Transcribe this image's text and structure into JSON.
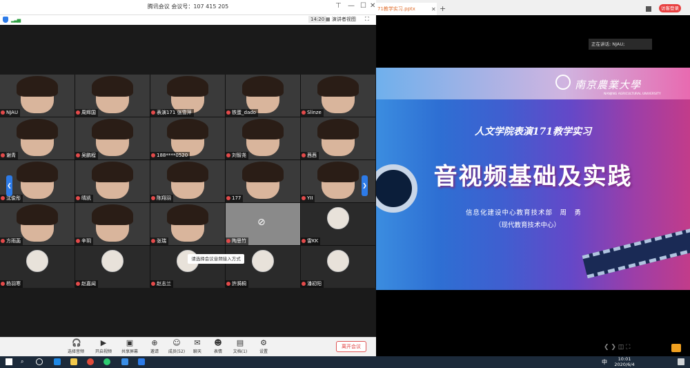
{
  "meeting": {
    "title": "腾讯会议 会议号：107 415 205",
    "clock": "14:20",
    "view_label": "演讲者视图",
    "tooltip": "请选择会议音频接入方式",
    "leave_label": "离开会议",
    "participants": [
      "NJAU",
      "周辉国",
      "表演171 张雪萍",
      "铁蛋_dado",
      "Slinze",
      "谢青",
      "吴鹏程",
      "188****0520",
      "刘智尧",
      "茜茜",
      "沈俊彤",
      "晴凯",
      "陈翔羽",
      "177",
      "YII",
      "方雨菡",
      "辛玥",
      "张瑞",
      "陶思竹",
      "雷KK",
      "杨羽寒",
      "赵嘉闻",
      "赵志兰",
      "許漪桐",
      "潘初阳"
    ],
    "toolbar": [
      {
        "label": "选择音频",
        "icon": "headset-icon"
      },
      {
        "label": "开启视频",
        "icon": "camera-off-icon"
      },
      {
        "label": "共享屏幕",
        "icon": "share-screen-icon"
      },
      {
        "label": "邀请",
        "icon": "invite-icon"
      },
      {
        "label": "成员(52)",
        "icon": "members-icon"
      },
      {
        "label": "聊天",
        "icon": "chat-icon"
      },
      {
        "label": "表情",
        "icon": "emoji-icon"
      },
      {
        "label": "文档(1)",
        "icon": "document-icon"
      },
      {
        "label": "设置",
        "icon": "settings-icon"
      }
    ]
  },
  "ppt": {
    "tab_title": "71教学实习.pptx",
    "login_button": "访客登录",
    "speaking": "正在讲话: NJAU;",
    "slide": {
      "school": "南京農業大學",
      "school_en": "NANJING AGRICULTURAL UNIVERSITY",
      "subtitle": "人文学院表演171教学实习",
      "main_title": "音视频基础及实践",
      "dept": "信息化建设中心教育技术部　周　勇",
      "dept2": "（现代教育技术中心）"
    }
  },
  "taskbar": {
    "time": "10:01",
    "date": "2020/6/4",
    "ime": "中"
  },
  "colors": {
    "accent_blue": "#2d7be8",
    "leave_red": "#e04040",
    "tab_orange": "#e07030"
  }
}
